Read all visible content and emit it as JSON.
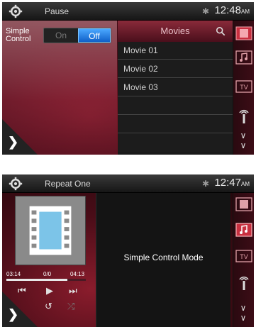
{
  "screen1": {
    "status": "Pause",
    "time": "12:48",
    "ampm": "AM",
    "simple_control_label": "Simple\nControl",
    "toggle_on": "On",
    "toggle_off": "Off",
    "movies_title": "Movies",
    "movies": [
      "Movie 01",
      "Movie 02",
      "Movie 03"
    ]
  },
  "screen2": {
    "status": "Repeat One",
    "time": "12:47",
    "ampm": "AM",
    "time_elapsed": "03:14",
    "track_index": "0/0",
    "time_total": "04:13",
    "progress": 0.77,
    "main_text": "Simple Control Mode"
  },
  "icons": {
    "settings": "gear-icon",
    "bluetooth": "bluetooth-icon",
    "film": "film-icon",
    "music": "music-note-icon",
    "tv": "tv-icon",
    "radio": "radio-antenna-icon",
    "search": "search-icon",
    "next": "chevron-right-icon",
    "down": "double-chevron-down-icon"
  },
  "colors": {
    "accent": "#1a7ae0",
    "background": "#4a0d18"
  }
}
